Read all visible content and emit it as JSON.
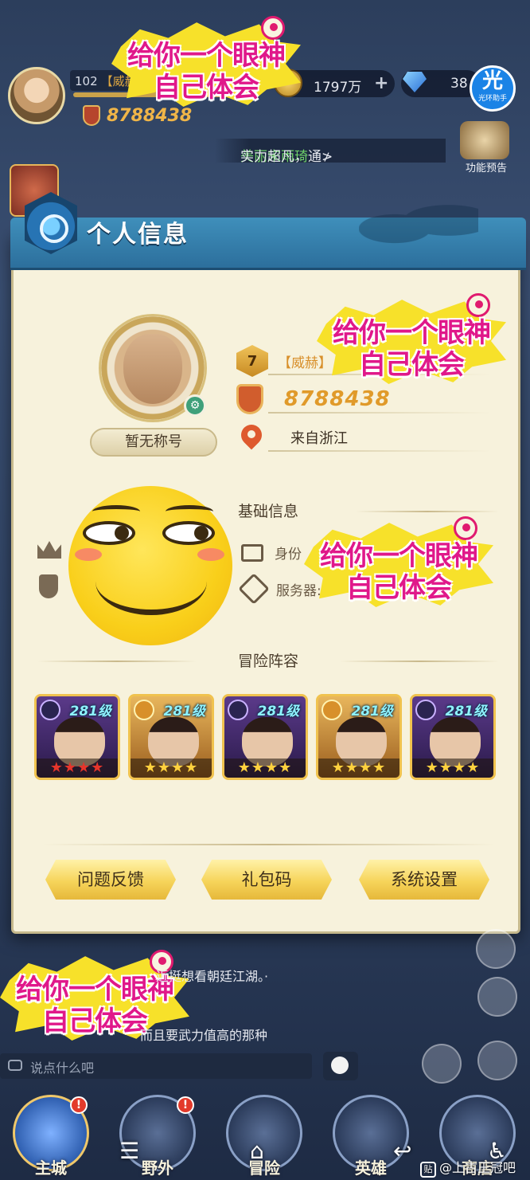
{
  "hud": {
    "level": "102",
    "title_tag": "【威赫",
    "power": "8788438",
    "gold": "1797万",
    "gems": "38",
    "helper_big": "光",
    "helper_small": "光环助手",
    "ticker_name": "美丽宋雨琦",
    "ticker_text": "实力超凡，通≯",
    "preview_label": "功能预告"
  },
  "panel": {
    "title": "个人信息",
    "profile": {
      "honor_title": "暂无称号",
      "level": "7",
      "level_title": "【威赫】",
      "power": "8788438",
      "location": "来自浙江"
    },
    "basic_section": {
      "title": "基础信息",
      "id_label": "身份",
      "server_label": "服务器:"
    },
    "team_section": {
      "title": "冒险阵容",
      "heroes": [
        {
          "level": "281级",
          "frame": "purple",
          "stars": "★★★★",
          "star_color": "red"
        },
        {
          "level": "281级",
          "frame": "gold",
          "stars": "★★★★",
          "star_color": "yel"
        },
        {
          "level": "281级",
          "frame": "purple",
          "stars": "★★★★",
          "star_color": "yel"
        },
        {
          "level": "281级",
          "frame": "gold",
          "stars": "★★★★",
          "star_color": "yel"
        },
        {
          "level": "281级",
          "frame": "purple",
          "stars": "★★★★",
          "star_color": "yel"
        }
      ]
    },
    "buttons": {
      "feedback": "问题反馈",
      "gift_code": "礼包码",
      "settings": "系统设置"
    }
  },
  "stickers": {
    "line1": "给你一个眼神",
    "line2": "自己体会"
  },
  "chat": {
    "line_a": "近挺想看朝廷江湖。·",
    "line_b": "而且要武力值高的那种",
    "placeholder": "说点什么吧"
  },
  "nav": {
    "items": [
      {
        "label": "主城",
        "alert": "!"
      },
      {
        "label": "野外",
        "alert": "!"
      },
      {
        "label": "冒险",
        "alert": ""
      },
      {
        "label": "英雄",
        "alert": ""
      },
      {
        "label": "商店",
        "alert": ""
      }
    ]
  },
  "watermark": {
    "badge": "贴",
    "text": "@上古王冠吧"
  },
  "colors": {
    "panel_bg": "#f7f2dc",
    "header_blue": "#2c6f9c",
    "accent_gold": "#e09a2a",
    "sticker_pink": "#e0188a",
    "sticker_yellow": "#f7e12a"
  }
}
